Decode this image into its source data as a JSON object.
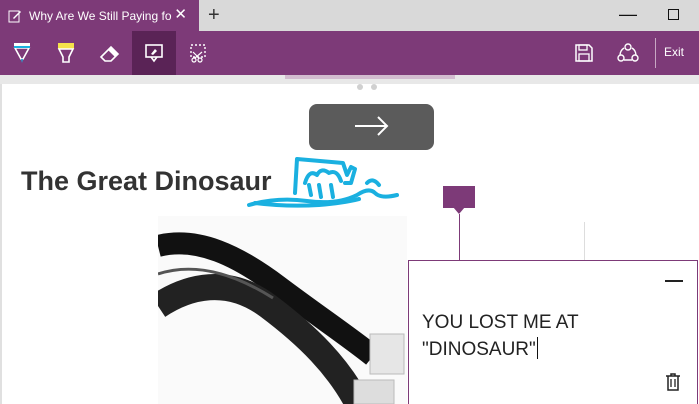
{
  "browser": {
    "tab_title": "Why Are We Still Paying fo",
    "tab_close": "✕",
    "new_tab": "+",
    "minimize": "—"
  },
  "toolbar": {
    "tools": [
      "pen-icon",
      "highlighter-icon",
      "eraser-icon",
      "add-note-icon",
      "clip-icon"
    ],
    "active_tool": "add-note-icon",
    "save": "save-icon",
    "share": "share-icon",
    "exit_label": "Exit"
  },
  "page": {
    "headline": "The Great Dinosaur"
  },
  "note": {
    "line1": "YOU LOST ME AT",
    "line2": "\"DINOSAUR\""
  },
  "colors": {
    "accent": "#7d3a78",
    "ink": "#1ab0e0",
    "toolbar_active": "#5a2356"
  }
}
